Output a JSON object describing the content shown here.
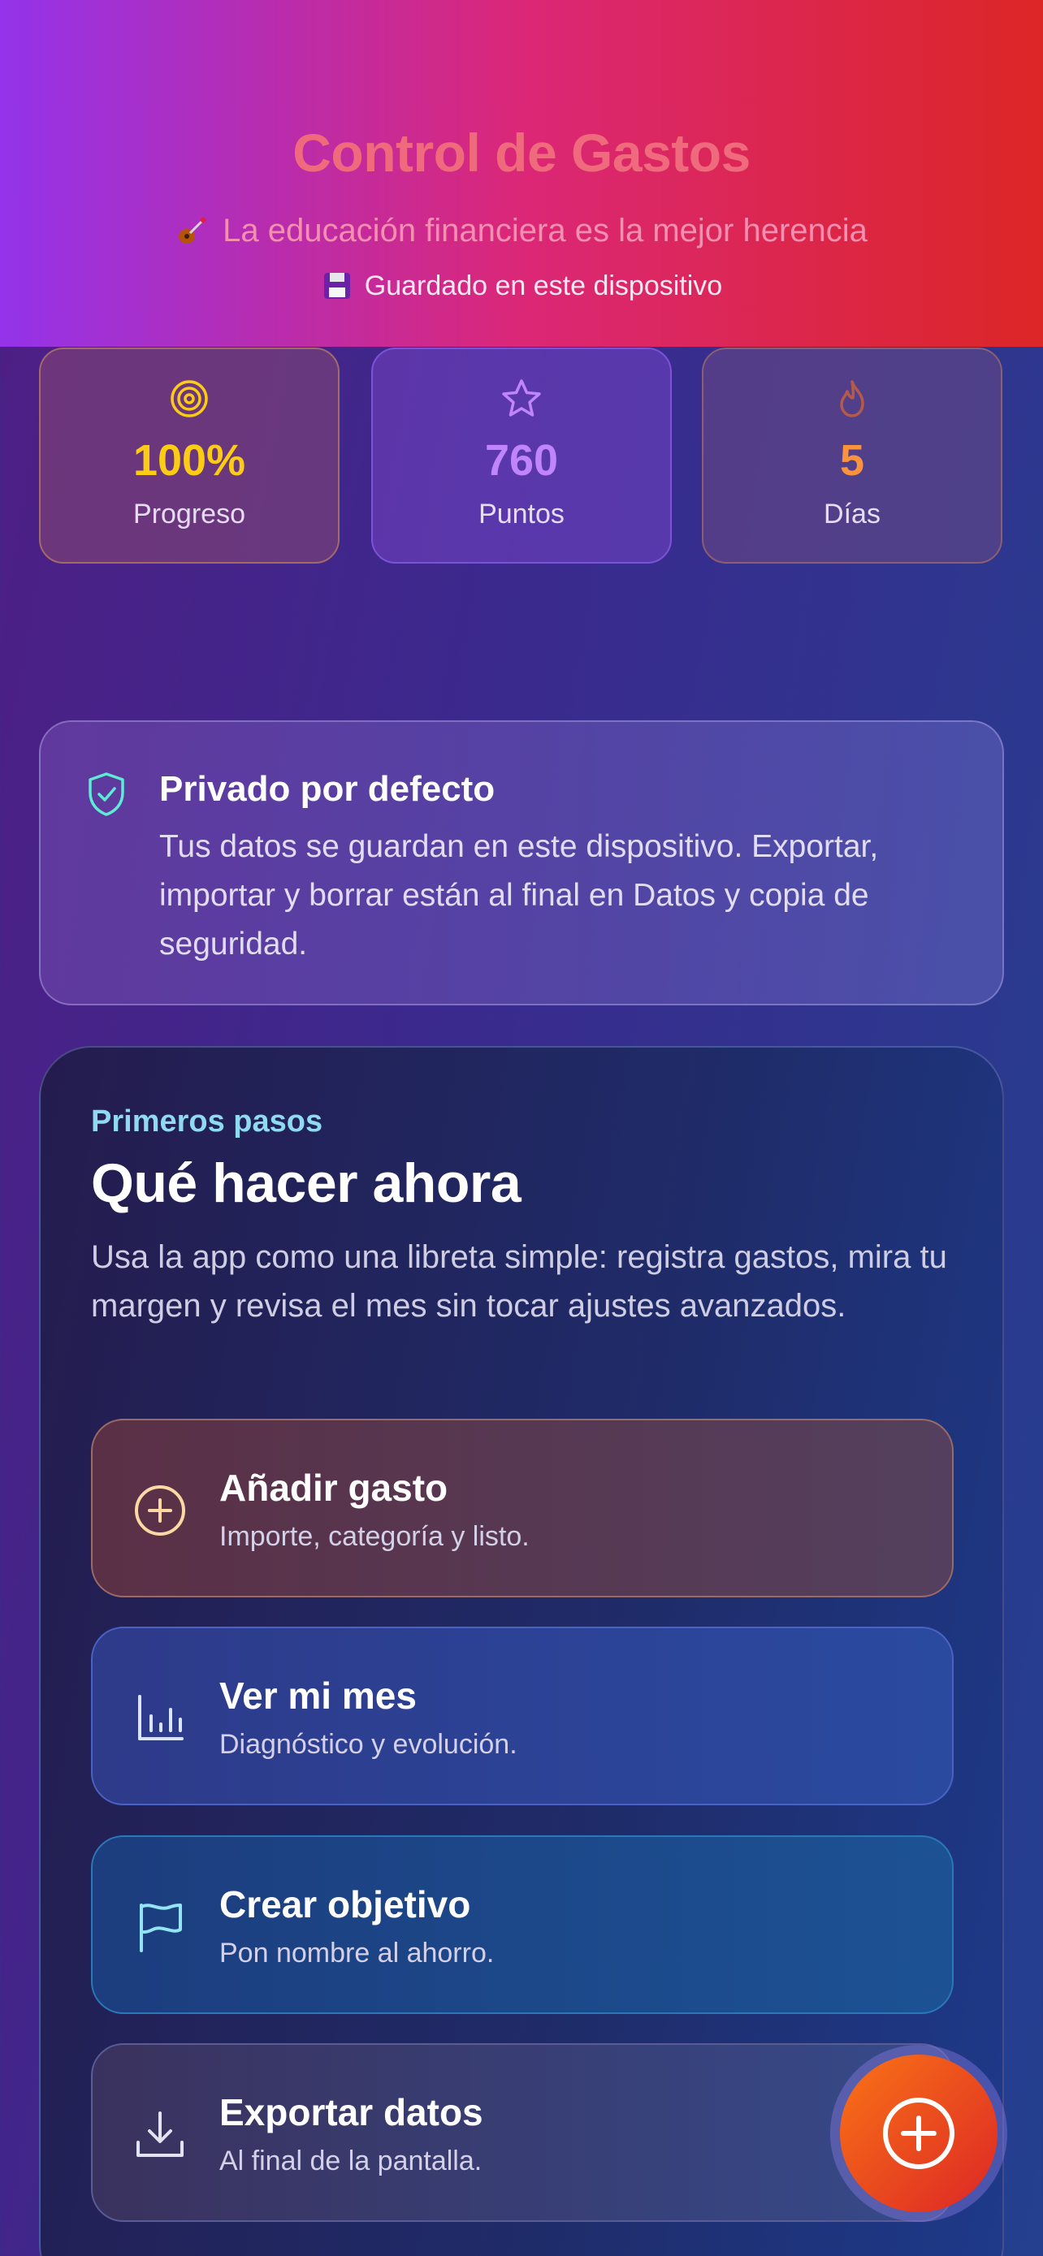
{
  "header": {
    "title": "Control de Gastos",
    "tagline": "La educación financiera es la mejor herencia",
    "tagline_icon": "guitar-emoji",
    "saved_status": "Guardado en este dispositivo",
    "saved_icon": "floppy-disk-emoji",
    "gradient": [
      "#9333ea",
      "#db2777",
      "#dc2626"
    ]
  },
  "stats": [
    {
      "icon": "target-icon",
      "value": "100%",
      "label": "Progreso",
      "color": "#facc15"
    },
    {
      "icon": "star-icon",
      "value": "760",
      "label": "Puntos",
      "color": "#c084fc"
    },
    {
      "icon": "flame-icon",
      "value": "5",
      "label": "Días",
      "color": "#fb923c"
    }
  ],
  "privacy": {
    "icon": "shield-check-icon",
    "title": "Privado por defecto",
    "text": "Tus datos se guardan en este dispositivo. Exportar, importar y borrar están al final en Datos y copia de seguridad."
  },
  "steps": {
    "eyebrow": "Primeros pasos",
    "heading": "Qué hacer ahora",
    "description": "Usa la app como una libreta simple: registra gastos, mira tu margen y revisa el mes sin tocar ajustes avanzados.",
    "actions": [
      {
        "icon": "plus-circle-icon",
        "title": "Añadir gasto",
        "subtitle": "Importe, categoría y listo."
      },
      {
        "icon": "bar-chart-icon",
        "title": "Ver mi mes",
        "subtitle": "Diagnóstico y evolución."
      },
      {
        "icon": "flag-icon",
        "title": "Crear objetivo",
        "subtitle": "Pon nombre al ahorro."
      },
      {
        "icon": "download-icon",
        "title": "Exportar datos",
        "subtitle": "Al final de la pantalla."
      }
    ]
  },
  "fab": {
    "icon": "plus-circle-icon"
  }
}
